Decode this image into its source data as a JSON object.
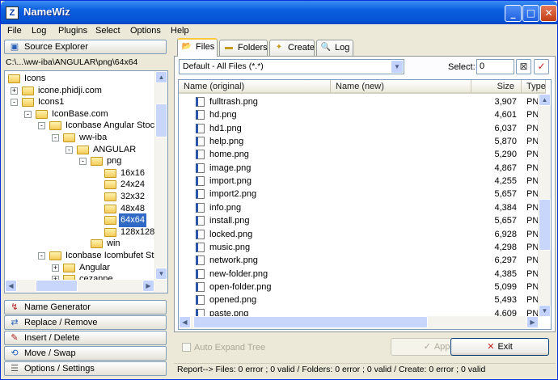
{
  "window": {
    "title": "NameWiz",
    "app_icon_letter": "Z"
  },
  "menu": [
    "File",
    "Log",
    "Plugins",
    "Select",
    "Options",
    "Help"
  ],
  "left_panel": {
    "source_explorer_label": "Source Explorer",
    "path": "C:\\...\\ww-iba\\ANGULAR\\png\\64x64",
    "tree": [
      {
        "label": "Icons",
        "depth": 0,
        "expander": "",
        "selected": false
      },
      {
        "label": "icone.phidji.com",
        "depth": 1,
        "expander": "+",
        "selected": false
      },
      {
        "label": "Icons1",
        "depth": 1,
        "expander": "-",
        "selected": false
      },
      {
        "label": "IconBase.com",
        "depth": 2,
        "expander": "-",
        "selected": false
      },
      {
        "label": "Iconbase Angular Stock",
        "depth": 3,
        "expander": "-",
        "selected": false
      },
      {
        "label": "ww-iba",
        "depth": 4,
        "expander": "-",
        "selected": false
      },
      {
        "label": "ANGULAR",
        "depth": 5,
        "expander": "-",
        "selected": false
      },
      {
        "label": "png",
        "depth": 6,
        "expander": "-",
        "selected": false
      },
      {
        "label": "16x16",
        "depth": 7,
        "expander": "",
        "selected": false
      },
      {
        "label": "24x24",
        "depth": 7,
        "expander": "",
        "selected": false
      },
      {
        "label": "32x32",
        "depth": 7,
        "expander": "",
        "selected": false
      },
      {
        "label": "48x48",
        "depth": 7,
        "expander": "",
        "selected": false
      },
      {
        "label": "64x64",
        "depth": 7,
        "expander": "",
        "selected": true
      },
      {
        "label": "128x128",
        "depth": 7,
        "expander": "",
        "selected": false
      },
      {
        "label": "win",
        "depth": 6,
        "expander": "",
        "selected": false
      },
      {
        "label": "Iconbase Icombufet Stoc",
        "depth": 3,
        "expander": "-",
        "selected": false
      },
      {
        "label": "Angular",
        "depth": 4,
        "expander": "+",
        "selected": false
      },
      {
        "label": "cezanne",
        "depth": 4,
        "expander": "+",
        "selected": false
      }
    ],
    "sections": [
      "Name Generator",
      "Replace / Remove",
      "Insert / Delete",
      "Move / Swap",
      "Options / Settings"
    ]
  },
  "tabs": [
    "Files",
    "Folders",
    "Create",
    "Log"
  ],
  "active_tab": "Files",
  "filter": {
    "value": "Default - All Files (*.*)"
  },
  "select": {
    "label": "Select:",
    "value": "0"
  },
  "columns": {
    "name_original": "Name (original)",
    "name_new": "Name (new)",
    "size": "Size",
    "type": "Type"
  },
  "files": [
    {
      "name": "fulltrash.png",
      "size": "3,907",
      "type": "PN"
    },
    {
      "name": "hd.png",
      "size": "4,601",
      "type": "PN"
    },
    {
      "name": "hd1.png",
      "size": "6,037",
      "type": "PN"
    },
    {
      "name": "help.png",
      "size": "5,870",
      "type": "PN"
    },
    {
      "name": "home.png",
      "size": "5,290",
      "type": "PN"
    },
    {
      "name": "image.png",
      "size": "4,867",
      "type": "PN"
    },
    {
      "name": "import.png",
      "size": "4,255",
      "type": "PN"
    },
    {
      "name": "import2.png",
      "size": "5,657",
      "type": "PN"
    },
    {
      "name": "info.png",
      "size": "4,384",
      "type": "PN"
    },
    {
      "name": "install.png",
      "size": "5,657",
      "type": "PN"
    },
    {
      "name": "locked.png",
      "size": "6,928",
      "type": "PN"
    },
    {
      "name": "music.png",
      "size": "4,298",
      "type": "PN"
    },
    {
      "name": "network.png",
      "size": "6,297",
      "type": "PN"
    },
    {
      "name": "new-folder.png",
      "size": "4,385",
      "type": "PN"
    },
    {
      "name": "open-folder.png",
      "size": "5,099",
      "type": "PN"
    },
    {
      "name": "opened.png",
      "size": "5,493",
      "type": "PN"
    },
    {
      "name": "paste.png",
      "size": "4,609",
      "type": "PN"
    }
  ],
  "auto_expand_label": "Auto Expand Tree",
  "apply_label": "Apply",
  "exit_label": "Exit",
  "status": "Report--> Files: 0 error ; 0 valid  /  Folders: 0 error ; 0 valid  /  Create: 0 error ; 0 valid",
  "colors": {
    "title_blue": "#0a5fe0",
    "selection": "#316ac5",
    "tab_highlight": "#ffc83c"
  }
}
